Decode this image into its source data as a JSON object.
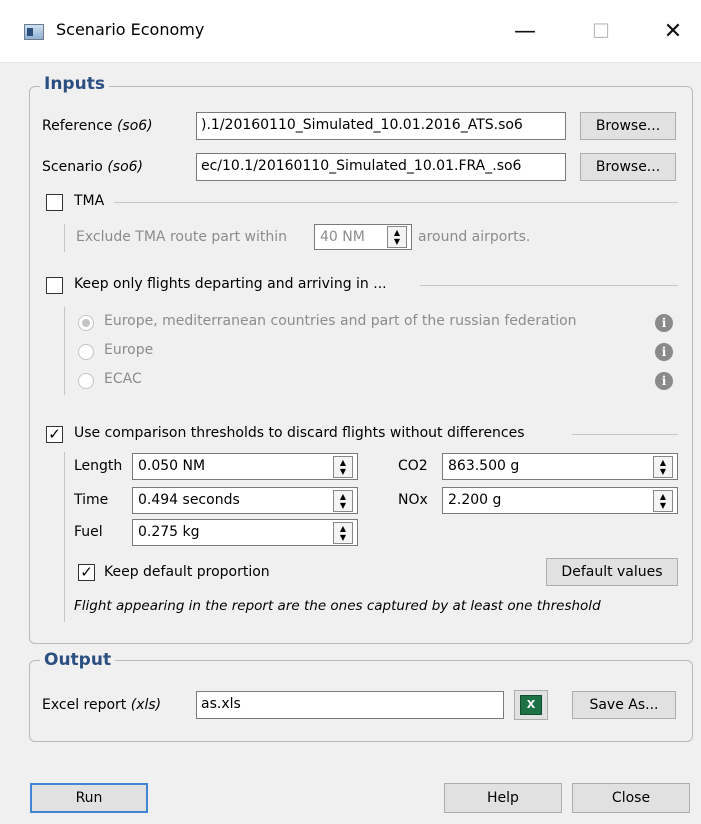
{
  "window": {
    "title": "Scenario Economy",
    "minimize": "—",
    "maximize": "☐",
    "close": "✕"
  },
  "inputs": {
    "title": "Inputs",
    "reference": {
      "label": "Reference",
      "hint": "(so6)",
      "value": ").1/20160110_Simulated_10.01.2016_ATS.so6",
      "browse": "Browse..."
    },
    "scenario": {
      "label": "Scenario",
      "hint": "(so6)",
      "value": "ec/10.1/20160110_Simulated_10.01.FRA_.so6",
      "browse": "Browse..."
    },
    "tma": {
      "label": "TMA",
      "checked": false,
      "exclude_prefix": "Exclude TMA route part within",
      "distance": "40 NM",
      "exclude_suffix": "around airports."
    },
    "keep_flights": {
      "label": "Keep only flights departing and arriving in ...",
      "checked": false,
      "options": [
        {
          "label": "Europe, mediterranean countries and part of the russian federation",
          "selected": true
        },
        {
          "label": "Europe",
          "selected": false
        },
        {
          "label": "ECAC",
          "selected": false
        }
      ]
    },
    "thresholds": {
      "label": "Use comparison thresholds to discard flights without differences",
      "checked": true,
      "length": {
        "label": "Length",
        "value": "0.050 NM"
      },
      "time": {
        "label": "Time",
        "value": "0.494 seconds"
      },
      "fuel": {
        "label": "Fuel",
        "value": "0.275 kg"
      },
      "co2": {
        "label": "CO2",
        "value": "863.500 g"
      },
      "nox": {
        "label": "NOx",
        "value": "2.200 g"
      },
      "keep_default": {
        "label": "Keep default proportion",
        "checked": true
      },
      "default_values": "Default values",
      "note": "Flight appearing in the report are the ones captured by at least one threshold"
    }
  },
  "output": {
    "title": "Output",
    "excel": {
      "label": "Excel report",
      "hint": "(xls)",
      "value": "as.xls",
      "save_as": "Save As..."
    }
  },
  "footer": {
    "run": "Run",
    "help": "Help",
    "close": "Close"
  },
  "icons": {
    "app": "window-app-icon",
    "info": "info-icon",
    "excel": "excel-icon"
  },
  "colors": {
    "group_title": "#2b4f80",
    "default_button_border": "#3f87d3"
  }
}
